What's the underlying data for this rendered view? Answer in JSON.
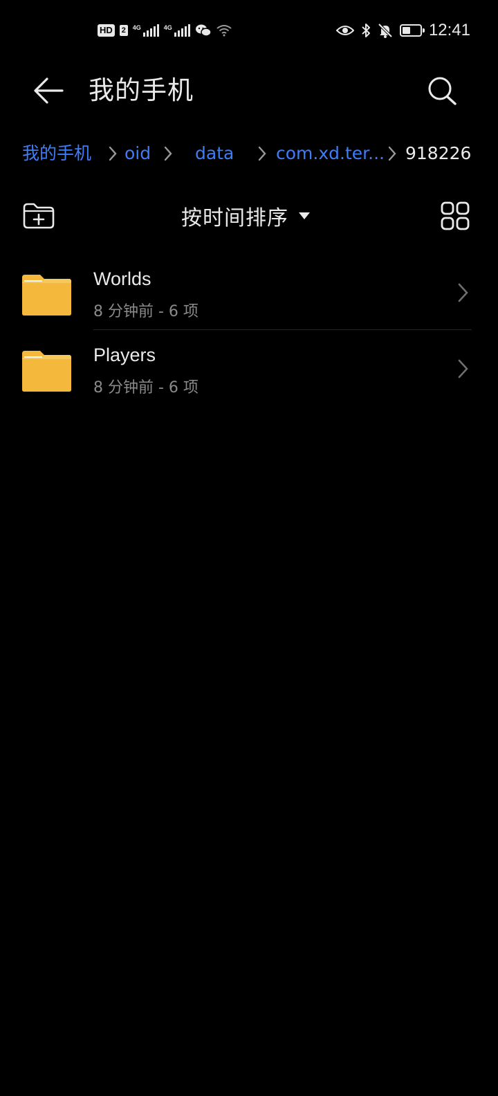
{
  "status_bar": {
    "hd_badge": "HD",
    "sim_badge": "2",
    "network_1": "4G",
    "network_2": "4G",
    "signal_1": "signal-icon",
    "signal_2": "signal-icon",
    "wechat_icon": "wechat-icon",
    "wifi_icon": "wifi-icon",
    "eye_icon": "eye-icon",
    "bluetooth_icon": "bluetooth-icon",
    "mute_icon": "bell-off-icon",
    "battery_level": 0.45,
    "time": "12:41"
  },
  "header": {
    "back_icon": "arrow-left-icon",
    "title": "我的手机",
    "search_icon": "search-icon"
  },
  "breadcrumb": {
    "items": [
      {
        "label": "我的手机",
        "current": false
      },
      {
        "label": "oid",
        "current": false
      },
      {
        "label": "data",
        "current": false
      },
      {
        "label": "com.xd.ter...",
        "current": false
      },
      {
        "label": "918226",
        "current": true
      }
    ],
    "separator_icon": "chevron-right-icon"
  },
  "toolbar": {
    "new_folder_icon": "folder-plus-icon",
    "sort_label": "按时间排序",
    "sort_icon": "caret-down-icon",
    "view_icon": "grid-view-icon"
  },
  "files": [
    {
      "name": "Worlds",
      "meta": "8 分钟前 - 6 项",
      "icon": "folder-icon"
    },
    {
      "name": "Players",
      "meta": "8 分钟前 - 6 项",
      "icon": "folder-icon"
    }
  ],
  "colors": {
    "background": "#000000",
    "accent": "#3f7df6",
    "folder": "#f4b93c",
    "text": "#eaeaea",
    "subtext": "#8a8a8a"
  }
}
